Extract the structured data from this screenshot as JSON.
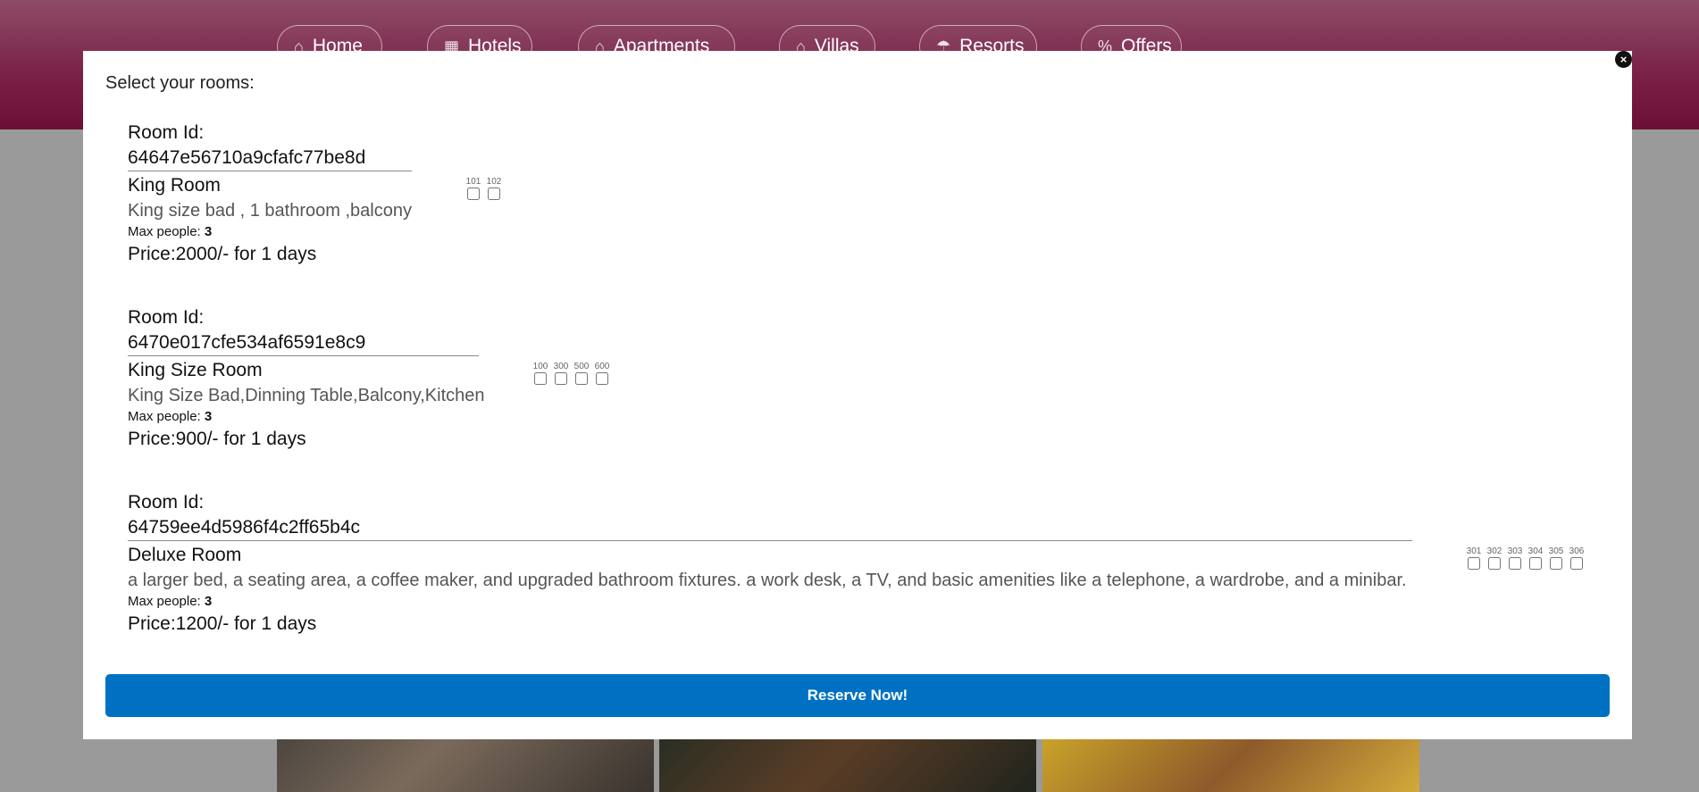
{
  "nav": {
    "items": [
      {
        "label": "Home",
        "icon": "home-icon",
        "glyph": "⌂"
      },
      {
        "label": "Hotels",
        "icon": "hotel-icon",
        "glyph": "▦"
      },
      {
        "label": "Apartments",
        "icon": "apartment-icon",
        "glyph": "⌂"
      },
      {
        "label": "Villas",
        "icon": "villa-icon",
        "glyph": "⌂"
      },
      {
        "label": "Resorts",
        "icon": "umbrella-icon",
        "glyph": "☂"
      },
      {
        "label": "Offers",
        "icon": "percent-icon",
        "glyph": "%"
      }
    ]
  },
  "modal": {
    "title": "Select your rooms:",
    "close_glyph": "×",
    "reserve_label": "Reserve Now!",
    "rooms": [
      {
        "id_label": "Room Id:",
        "id": "64647e56710a9cfafc77be8d",
        "title": "King Room",
        "desc": "King size bad , 1 bathroom ,balcony",
        "max_label": "Max people:",
        "max": "3",
        "price": "Price:2000/- for 1 days",
        "numbers": [
          "101",
          "102"
        ]
      },
      {
        "id_label": "Room Id:",
        "id": "6470e017cfe534af6591e8c9",
        "title": "King Size Room",
        "desc": "King Size Bad,Dinning Table,Balcony,Kitchen",
        "max_label": "Max people:",
        "max": "3",
        "price": "Price:900/- for 1 days",
        "numbers": [
          "100",
          "300",
          "500",
          "600"
        ]
      },
      {
        "id_label": "Room Id:",
        "id": "64759ee4d5986f4c2ff65b4c",
        "title": "Deluxe Room",
        "desc": "a larger bed, a seating area, a coffee maker, and upgraded bathroom fixtures. a work desk, a TV, and basic amenities like a telephone, a wardrobe, and a minibar.",
        "max_label": "Max people:",
        "max": "3",
        "price": "Price:1200/- for 1 days",
        "numbers": [
          "301",
          "302",
          "303",
          "304",
          "305",
          "306"
        ]
      }
    ]
  },
  "colors": {
    "header": "#7a1f45",
    "button": "#0071c2",
    "overlay": "#9a9a9a"
  }
}
